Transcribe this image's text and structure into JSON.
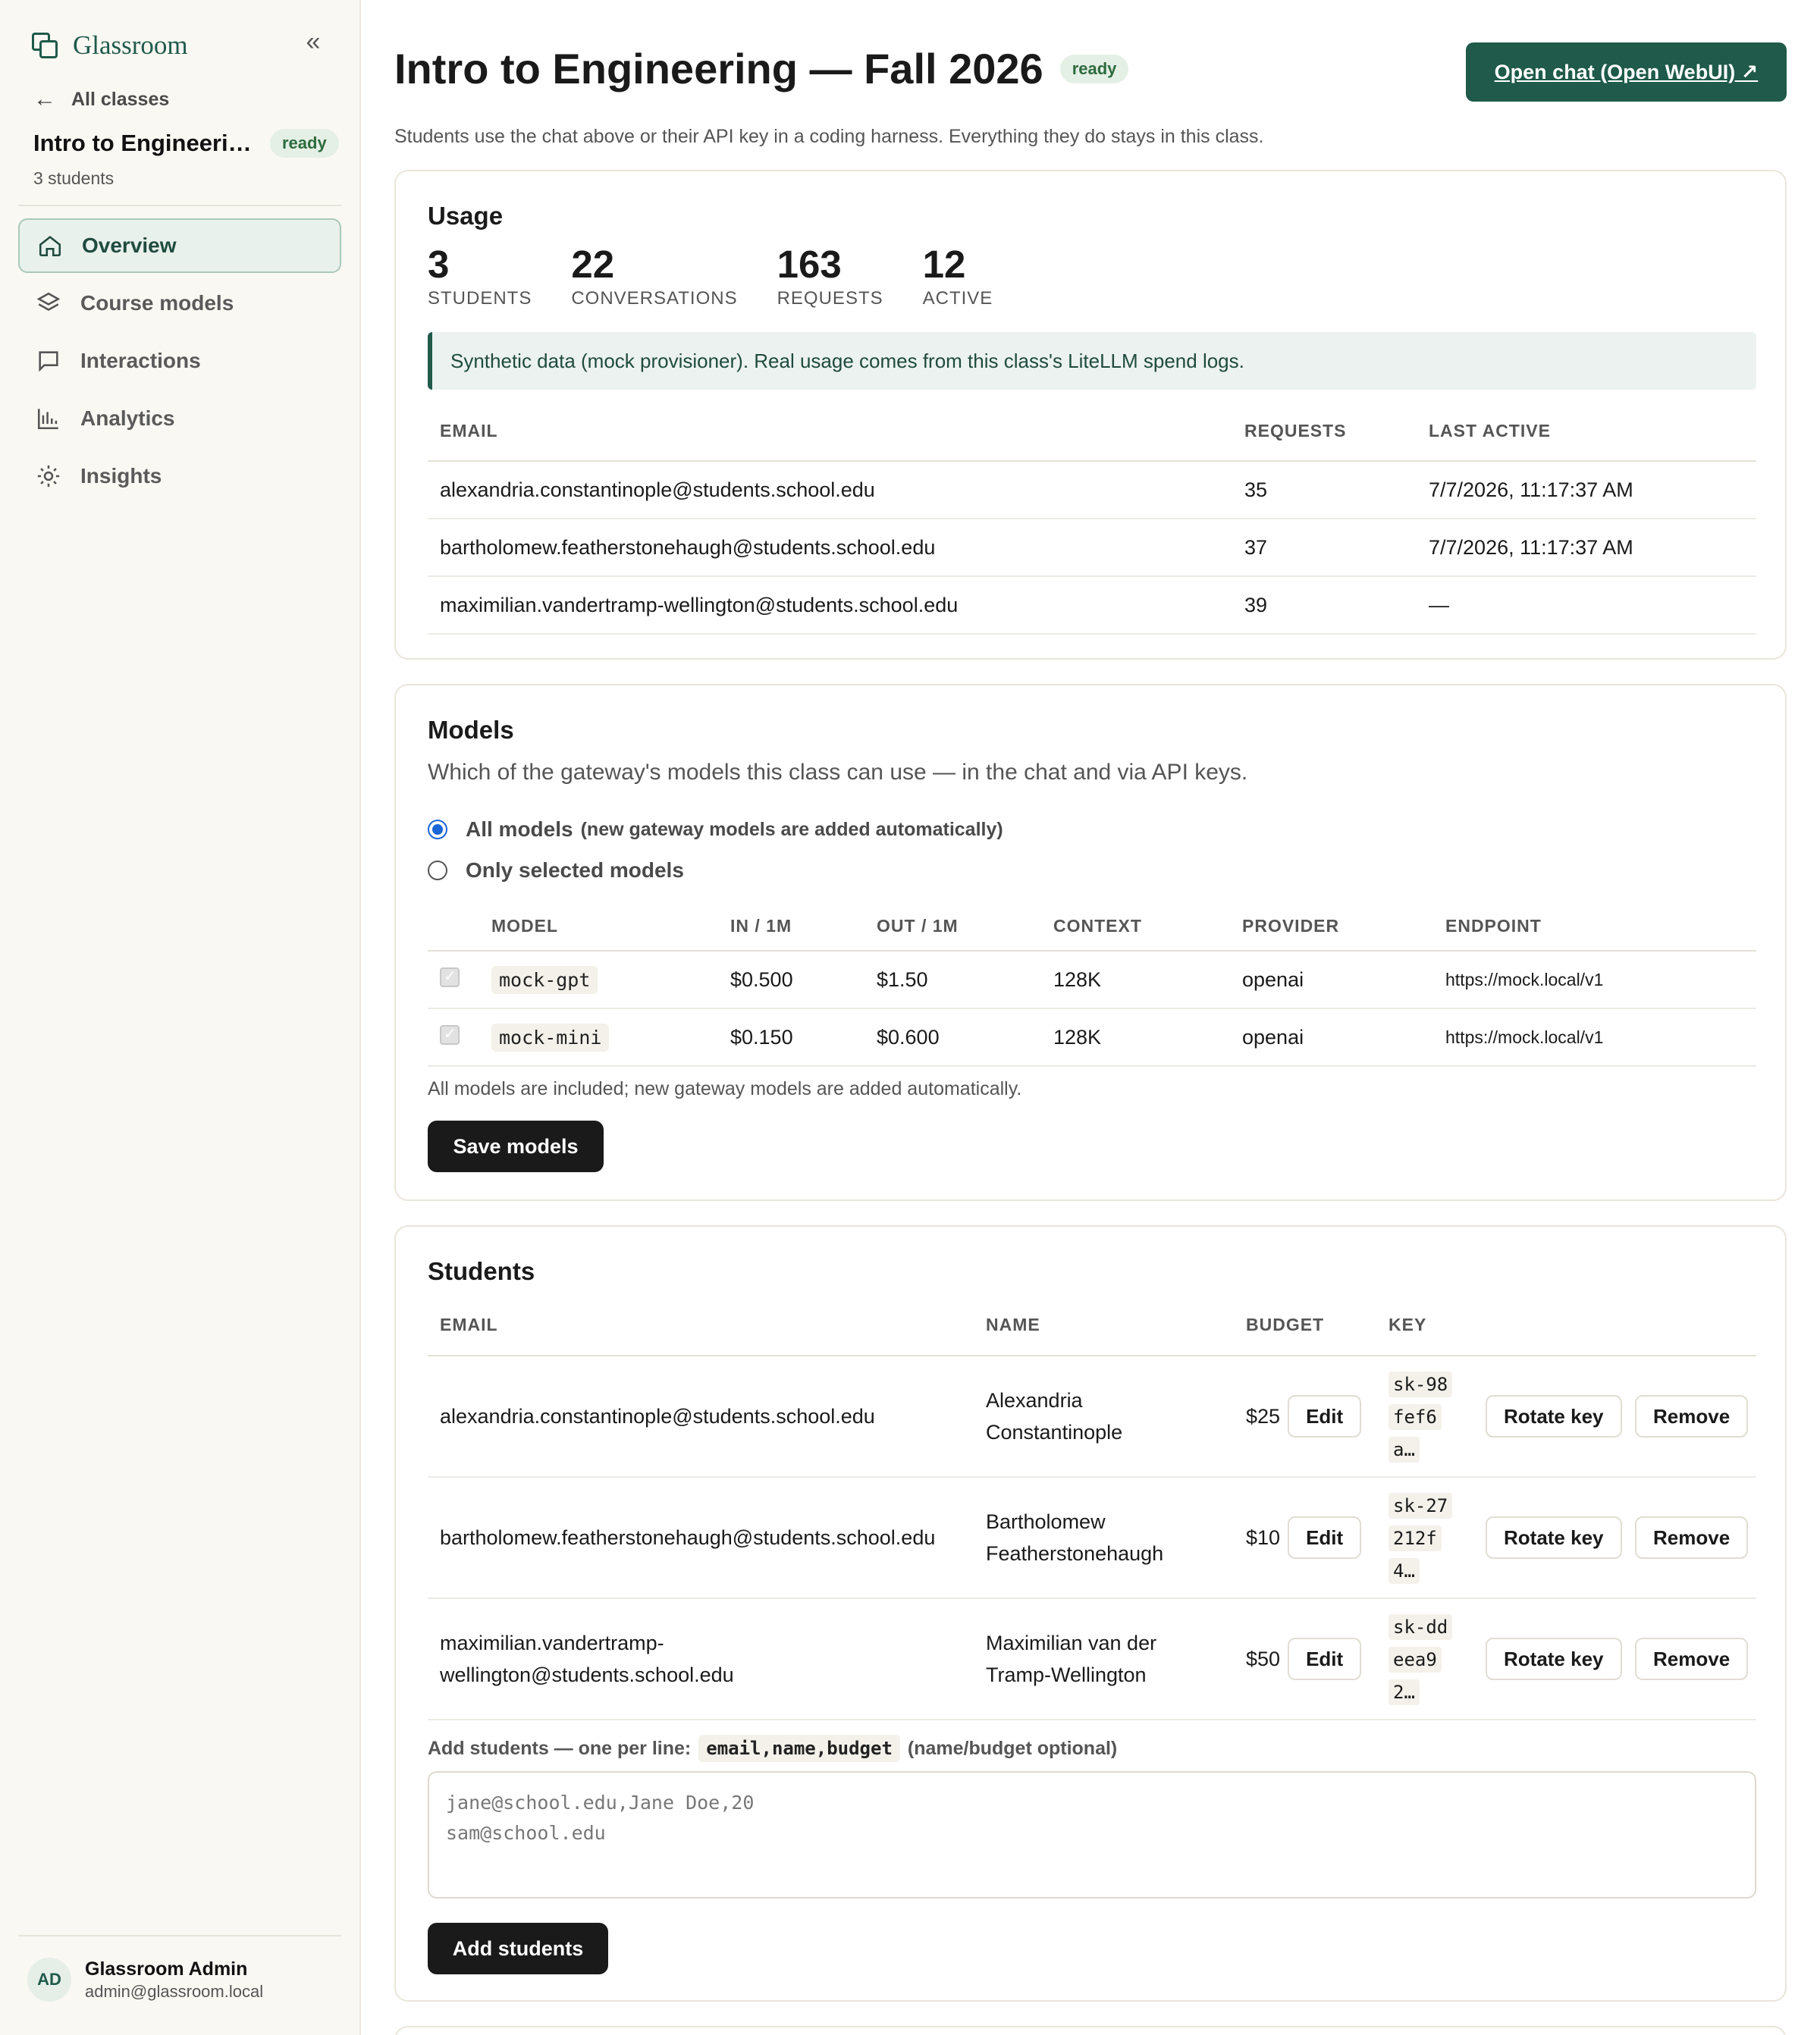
{
  "sidebar": {
    "brand": "Glassroom",
    "collapse_icon": "«",
    "back_label": "All classes",
    "class_name": "Intro to Engineering — Fall 2026",
    "class_status": "ready",
    "student_count": "3 students",
    "nav": [
      {
        "label": "Overview",
        "icon": "home-icon",
        "active": true
      },
      {
        "label": "Course models",
        "icon": "layers-icon",
        "active": false
      },
      {
        "label": "Interactions",
        "icon": "chat-icon",
        "active": false
      },
      {
        "label": "Analytics",
        "icon": "bar-chart-icon",
        "active": false
      },
      {
        "label": "Insights",
        "icon": "sun-icon",
        "active": false
      }
    ],
    "user": {
      "initials": "AD",
      "name": "Glassroom Admin",
      "email": "admin@glassroom.local"
    }
  },
  "header": {
    "title": "Intro to Engineering — Fall 2026",
    "status": "ready",
    "open_chat_label": "Open chat (Open WebUI) ↗",
    "subtitle": "Students use the chat above or their API key in a coding harness. Everything they do stays in this class."
  },
  "usage": {
    "title": "Usage",
    "stats": [
      {
        "value": "3",
        "label": "STUDENTS"
      },
      {
        "value": "22",
        "label": "CONVERSATIONS"
      },
      {
        "value": "163",
        "label": "REQUESTS"
      },
      {
        "value": "12",
        "label": "ACTIVE"
      }
    ],
    "notice": "Synthetic data (mock provisioner). Real usage comes from this class's LiteLLM spend logs.",
    "columns": [
      "EMAIL",
      "REQUESTS",
      "LAST ACTIVE"
    ],
    "rows": [
      {
        "email": "alexandria.constantinople@students.school.edu",
        "requests": "35",
        "last_active": "7/7/2026, 11:17:37 AM"
      },
      {
        "email": "bartholomew.featherstonehaugh@students.school.edu",
        "requests": "37",
        "last_active": "7/7/2026, 11:17:37 AM"
      },
      {
        "email": "maximilian.vandertramp-wellington@students.school.edu",
        "requests": "39",
        "last_active": "—"
      }
    ]
  },
  "models": {
    "title": "Models",
    "subtitle": "Which of the gateway's models this class can use — in the chat and via API keys.",
    "option_all": "All models",
    "option_all_note": "(new gateway models are added automatically)",
    "option_selected": "Only selected models",
    "columns": [
      "MODEL",
      "IN / 1M",
      "OUT / 1M",
      "CONTEXT",
      "PROVIDER",
      "ENDPOINT"
    ],
    "rows": [
      {
        "model": "mock-gpt",
        "in": "$0.500",
        "out": "$1.50",
        "context": "128K",
        "provider": "openai",
        "endpoint": "https://mock.local/v1"
      },
      {
        "model": "mock-mini",
        "in": "$0.150",
        "out": "$0.600",
        "context": "128K",
        "provider": "openai",
        "endpoint": "https://mock.local/v1"
      }
    ],
    "footnote": "All models are included; new gateway models are added automatically.",
    "save_label": "Save models"
  },
  "students": {
    "title": "Students",
    "columns": [
      "EMAIL",
      "NAME",
      "BUDGET",
      "KEY"
    ],
    "rows": [
      {
        "email": "alexandria.constantinople@students.school.edu",
        "name_line1": "Alexandria",
        "name_line2": "Constantinople",
        "budget": "$25",
        "key_l1": "sk-98",
        "key_l2": "fef6",
        "key_l3": "a…"
      },
      {
        "email": "bartholomew.featherstonehaugh@students.school.edu",
        "name_line1": "Bartholomew",
        "name_line2": "Featherstonehaugh",
        "budget": "$10",
        "key_l1": "sk-27",
        "key_l2": "212f",
        "key_l3": "4…"
      },
      {
        "email_line1": "maximilian.vandertramp-",
        "email_line2": "wellington@students.school.edu",
        "name_line1": "Maximilian van der",
        "name_line2": "Tramp-Wellington",
        "budget": "$50",
        "key_l1": "sk-dd",
        "key_l2": "eea9",
        "key_l3": "2…"
      }
    ],
    "edit_label": "Edit",
    "rotate_label": "Rotate key",
    "remove_label": "Remove",
    "add_label_prefix": "Add students — one per line:",
    "add_label_code": "email,name,budget",
    "add_label_suffix": "(name/budget optional)",
    "textarea_placeholder": "jane@school.edu,Jane Doe,20\nsam@school.edu",
    "add_button": "Add students"
  }
}
